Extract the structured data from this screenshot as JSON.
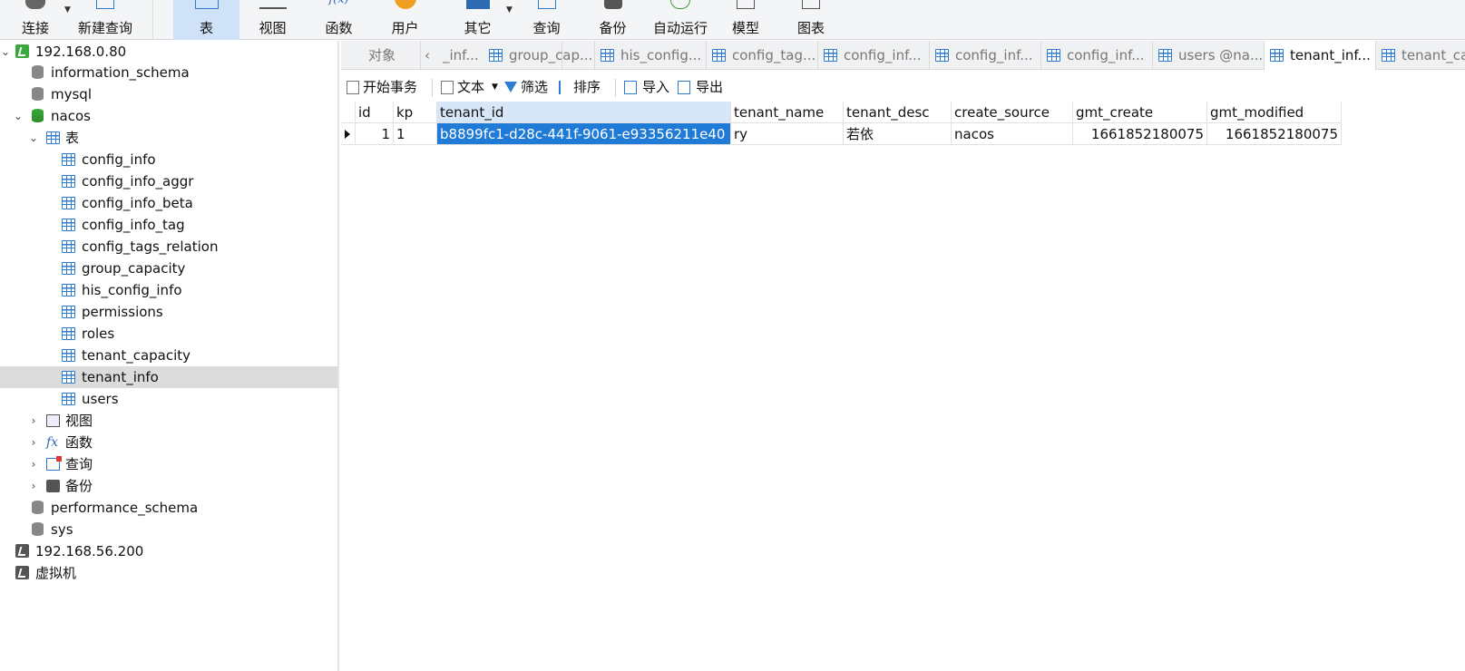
{
  "toolbar": {
    "connect": "连接",
    "new_query": "新建查询",
    "table": "表",
    "view": "视图",
    "function": "函数",
    "user": "用户",
    "other": "其它",
    "query": "查询",
    "backup": "备份",
    "auto_run": "自动运行",
    "model": "模型",
    "chart": "图表"
  },
  "tree": {
    "conn1": "192.168.0.80",
    "db_information_schema": "information_schema",
    "db_mysql": "mysql",
    "db_nacos": "nacos",
    "tables_folder": "表",
    "tables": [
      "config_info",
      "config_info_aggr",
      "config_info_beta",
      "config_info_tag",
      "config_tags_relation",
      "group_capacity",
      "his_config_info",
      "permissions",
      "roles",
      "tenant_capacity",
      "tenant_info",
      "users"
    ],
    "views": "视图",
    "functions": "函数",
    "queries": "查询",
    "backups": "备份",
    "db_performance_schema": "performance_schema",
    "db_sys": "sys",
    "conn2": "192.168.56.200",
    "conn3": "虚拟机"
  },
  "tabs": {
    "objects": "对象",
    "items": [
      "_inf...",
      "group_cap...",
      "his_config...",
      "config_tag...",
      "config_inf...",
      "config_inf...",
      "config_inf...",
      "users @na...",
      "tenant_inf...",
      "tenant_ca"
    ]
  },
  "datatools": {
    "begin_tx": "开始事务",
    "text": "文本",
    "filter": "筛选",
    "sort": "排序",
    "import": "导入",
    "export": "导出"
  },
  "grid": {
    "columns": [
      "id",
      "kp",
      "tenant_id",
      "tenant_name",
      "tenant_desc",
      "create_source",
      "gmt_create",
      "gmt_modified"
    ],
    "rows": [
      {
        "id": "1",
        "kp": "1",
        "tenant_id": "b8899fc1-d28c-441f-9061-e93356211e40",
        "tenant_name": "ry",
        "tenant_desc": "若依",
        "create_source": "nacos",
        "gmt_create": "1661852180075",
        "gmt_modified": "1661852180075"
      }
    ]
  }
}
